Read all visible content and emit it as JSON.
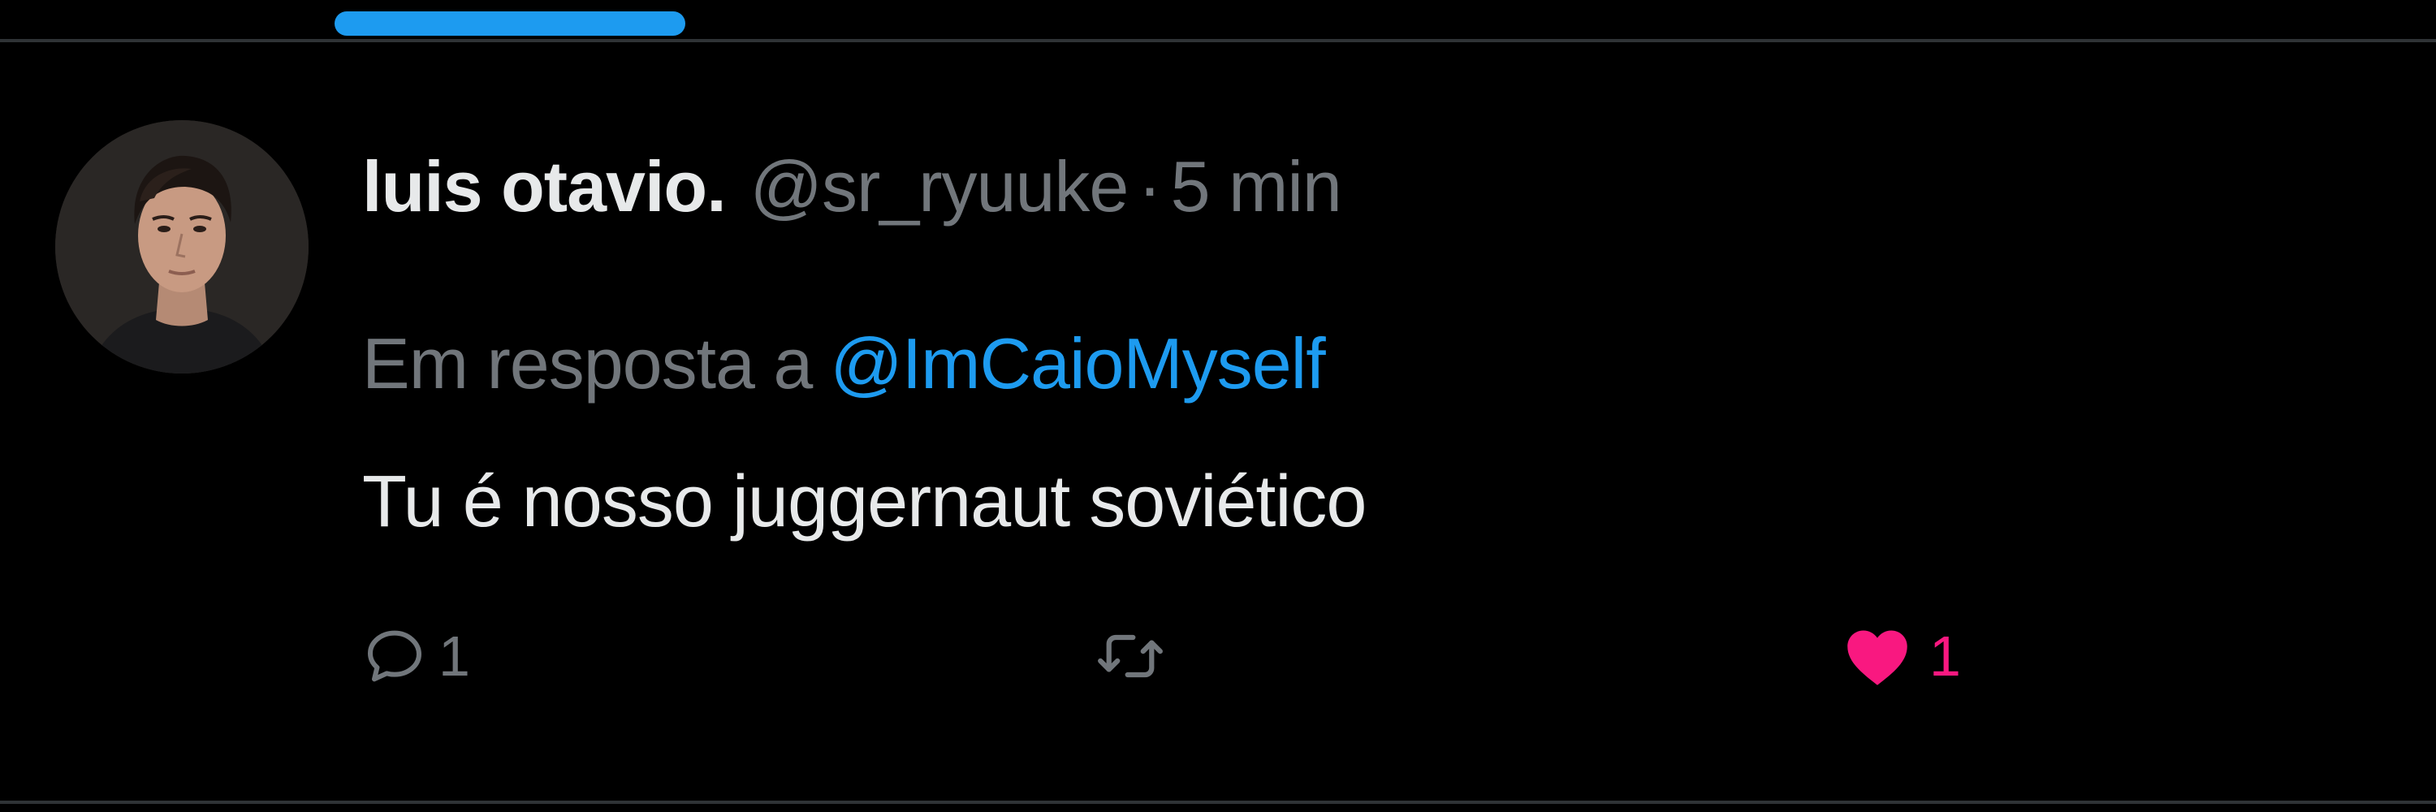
{
  "colors": {
    "background": "#000000",
    "divider": "#2f3336",
    "tab_indicator": "#1d9bf0",
    "primary_text": "#e7e9ea",
    "secondary_text": "#71767b",
    "link": "#1d9bf0",
    "like_active": "#f91880"
  },
  "tweet": {
    "author": {
      "display_name": "luis otavio.",
      "handle": "@sr_ryuuke",
      "avatar_icon": "user-avatar-photo"
    },
    "separator": "·",
    "timestamp": "5 min",
    "reply_context": {
      "prefix": "Em resposta a",
      "handle": "@ImCaioMyself"
    },
    "text": "Tu é nosso juggernaut soviético",
    "actions": {
      "reply": {
        "icon": "reply-icon",
        "count": "1"
      },
      "retweet": {
        "icon": "retweet-icon"
      },
      "like": {
        "icon": "heart-icon",
        "count": "1",
        "active": true
      }
    }
  }
}
